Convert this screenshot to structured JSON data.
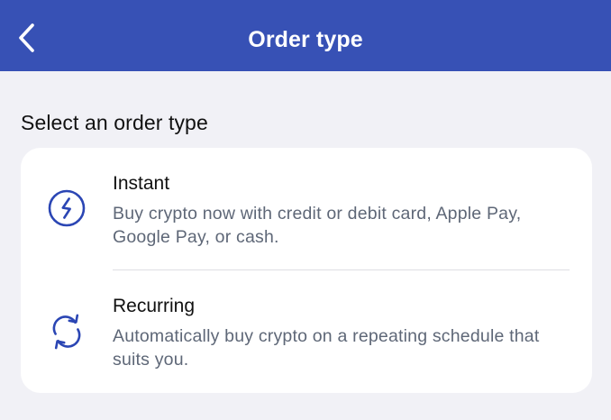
{
  "header": {
    "title": "Order type",
    "back_icon": "chevron-left-icon"
  },
  "section": {
    "heading": "Select an order type"
  },
  "options": [
    {
      "title": "Instant",
      "description": "Buy crypto now with credit or debit card, Apple Pay, Google Pay, or cash.",
      "icon": "lightning-circle-icon"
    },
    {
      "title": "Recurring",
      "description": "Automatically buy crypto on a repeating schedule that suits you.",
      "icon": "repeat-arrows-icon"
    }
  ],
  "colors": {
    "header_background": "#3751B5",
    "accent": "#2B46B4",
    "page_background": "#F1F1F6",
    "card_background": "#FFFFFF",
    "description_text": "#5E6777"
  }
}
